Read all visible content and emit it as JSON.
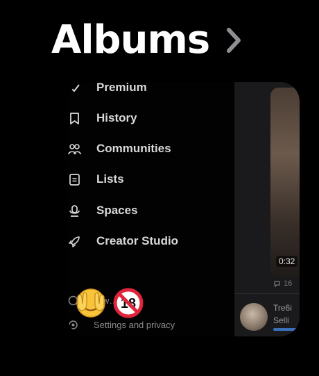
{
  "header": {
    "title": "Albums",
    "chevron_icon": "chevron-right-icon"
  },
  "menu": {
    "items": [
      {
        "label": "Premium",
        "icon": "premium-icon"
      },
      {
        "label": "History",
        "icon": "bookmark-icon"
      },
      {
        "label": "Communities",
        "icon": "communities-icon"
      },
      {
        "label": "Lists",
        "icon": "lists-icon"
      },
      {
        "label": "Spaces",
        "icon": "spaces-icon"
      },
      {
        "label": "Creator Studio",
        "icon": "rocket-icon"
      },
      {
        "label": "…w…rok",
        "icon": "grok-icon"
      },
      {
        "label": "Settings and privacy",
        "icon": "gear-icon"
      }
    ]
  },
  "preview": {
    "timestamp": "0:32",
    "stat_count": "16",
    "post_name": "Tre6i",
    "post_text": "Selli"
  },
  "overlay": {
    "emojis": [
      "see-no-evil-face-emoji",
      "no-one-under-18-emoji"
    ]
  },
  "colors": {
    "background": "#000000",
    "menu_text": "#d9d9d9",
    "muted_text": "#8a8a8a",
    "link": "#3a6fb8"
  }
}
